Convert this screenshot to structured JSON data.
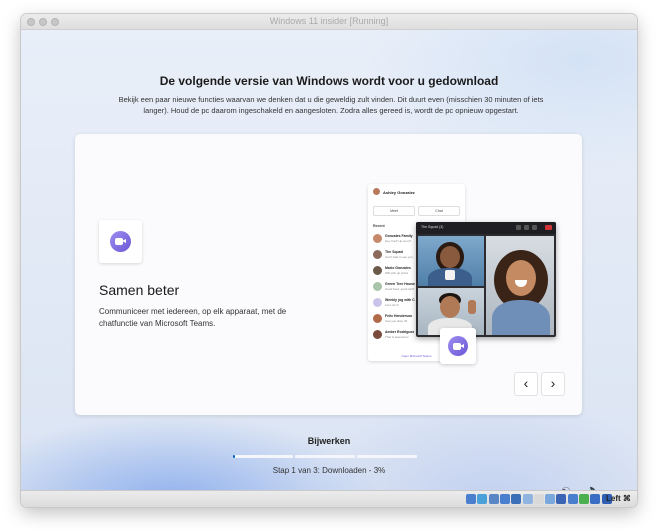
{
  "window": {
    "title": "Windows 11 insider [Running]"
  },
  "setup": {
    "heading": "De volgende versie van Windows wordt voor u gedownload",
    "subtext": "Bekijk een paar nieuwe functies waarvan we denken dat u die geweldig zult vinden. Dit duurt even (misschien 30 minuten of iets langer). Houd de pc daarom ingeschakeld en aangesloten. Zodra alles gereed is, wordt de pc opnieuw opgestart."
  },
  "feature_card": {
    "icon": "teams-chat-icon",
    "title": "Samen beter",
    "description": "Communiceer met iedereen, op elk apparaat, met de chatfunctie van Microsoft Teams.",
    "prev_icon": "‹",
    "next_icon": "›"
  },
  "chat_illustration": {
    "user": "Ashley Gonzalez",
    "meet_label": "Meet",
    "chat_label": "Chat",
    "recent_label": "Recent",
    "rows": [
      {
        "name": "Gonzales Family",
        "msg": "Hey Carl! Up soon?",
        "color": "#c48a6a"
      },
      {
        "name": "The Squad",
        "msg": "Can't wait to see you",
        "color": "#8a6a5a"
      },
      {
        "name": "Mario Gonzales",
        "msg": "Will pick up pizza",
        "color": "#6b5a4a"
      },
      {
        "name": "Green Tree House",
        "msg": "Good food, good stuff",
        "color": "#a9c4a8"
      },
      {
        "name": "Weekly jog with C",
        "msg": "Let's do it!",
        "color": "#c9c4e8"
      },
      {
        "name": "Felix Henderson",
        "msg": "Can you drop off",
        "color": "#b06a4a"
      },
      {
        "name": "Amber Rodriguez",
        "msg": "That is awesome!",
        "color": "#7a4a3a"
      }
    ],
    "footer": "Open Microsoft Teams"
  },
  "video_illustration": {
    "title": "The Squad (3)"
  },
  "progress": {
    "label": "Bijwerken",
    "step_text": "Stap 1 van 3: Downloaden - 3%",
    "step_fraction": 0.03,
    "current_step": 1,
    "total_steps": 3
  },
  "tray": {
    "accessibility_icon": "accessibility-icon",
    "volume_icon": "volume-icon"
  },
  "statusbar": {
    "host_key": "Left ⌘",
    "icons": [
      {
        "name": "harddisk-icon",
        "color": "#4a7fd0"
      },
      {
        "name": "optical-drive-icon",
        "color": "#4aa0d8"
      },
      {
        "name": "audio-icon",
        "color": "#5b86c6"
      },
      {
        "name": "network-icon",
        "color": "#4a7fd0"
      },
      {
        "name": "usb-icon",
        "color": "#3b6fb8"
      },
      {
        "name": "shared-folders-icon",
        "color": "#8fb4e0"
      },
      {
        "name": "display-icon",
        "color": "#d9d9d9"
      },
      {
        "name": "video-capture-icon",
        "color": "#7aa7dc"
      },
      {
        "name": "recording-icon",
        "color": "#3c64b4"
      },
      {
        "name": "guest-additions-icon",
        "color": "#4a7fd0"
      },
      {
        "name": "mouse-integration-icon",
        "color": "#4caf50"
      },
      {
        "name": "cpu-icon",
        "color": "#3a6ec4"
      },
      {
        "name": "host-key-icon",
        "color": "#2f5fb3"
      }
    ]
  }
}
